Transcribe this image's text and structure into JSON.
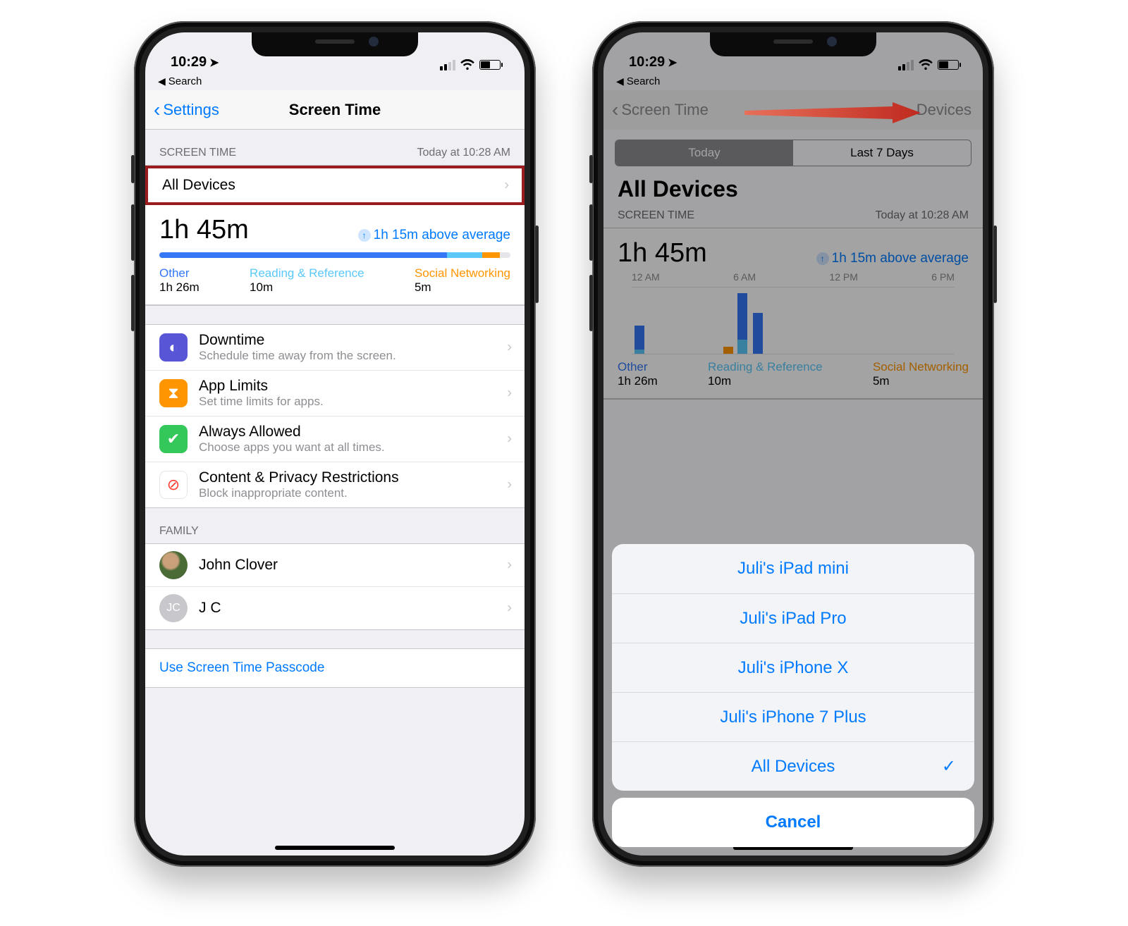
{
  "status": {
    "time": "10:29",
    "breadcrumb": "Search"
  },
  "left": {
    "nav": {
      "back": "Settings",
      "title": "Screen Time"
    },
    "header": {
      "label": "SCREEN TIME",
      "timestamp": "Today at 10:28 AM"
    },
    "all_devices_label": "All Devices",
    "summary": {
      "total": "1h 45m",
      "delta": "1h 15m above average",
      "categories": [
        {
          "name": "Other",
          "value": "1h 26m"
        },
        {
          "name": "Reading & Reference",
          "value": "10m"
        },
        {
          "name": "Social Networking",
          "value": "5m"
        }
      ]
    },
    "options": [
      {
        "title": "Downtime",
        "sub": "Schedule time away from the screen.",
        "color": "#5856d6",
        "glyph": "◐"
      },
      {
        "title": "App Limits",
        "sub": "Set time limits for apps.",
        "color": "#ff9500",
        "glyph": "⧗"
      },
      {
        "title": "Always Allowed",
        "sub": "Choose apps you want at all times.",
        "color": "#34c759",
        "glyph": "✔"
      },
      {
        "title": "Content & Privacy Restrictions",
        "sub": "Block inappropriate content.",
        "color": "#ff3b30",
        "glyph": "⊘"
      }
    ],
    "family_label": "FAMILY",
    "family": [
      {
        "name": "John Clover",
        "type": "photo"
      },
      {
        "name": "J C",
        "type": "initials",
        "initials": "JC"
      }
    ],
    "passcode_link": "Use Screen Time Passcode"
  },
  "right": {
    "nav": {
      "back": "Screen Time",
      "right": "Devices"
    },
    "segmented": {
      "today": "Today",
      "week": "Last 7 Days"
    },
    "big_title": "All Devices",
    "header": {
      "label": "SCREEN TIME",
      "timestamp": "Today at 10:28 AM"
    },
    "summary": {
      "total": "1h 45m",
      "delta": "1h 15m above average",
      "ticks": [
        "12 AM",
        "6 AM",
        "12 PM",
        "6 PM"
      ],
      "categories": [
        {
          "name": "Other",
          "value": "1h 26m"
        },
        {
          "name": "Reading & Reference",
          "value": "10m"
        },
        {
          "name": "Social Networking",
          "value": "5m"
        }
      ]
    },
    "sheet": {
      "items": [
        {
          "label": "Juli's iPad mini",
          "checked": false
        },
        {
          "label": "Juli's iPad Pro",
          "checked": false
        },
        {
          "label": "Juli's iPhone X",
          "checked": false
        },
        {
          "label": "Juli's iPhone 7 Plus",
          "checked": false
        },
        {
          "label": "All Devices",
          "checked": true
        }
      ],
      "cancel": "Cancel"
    }
  }
}
